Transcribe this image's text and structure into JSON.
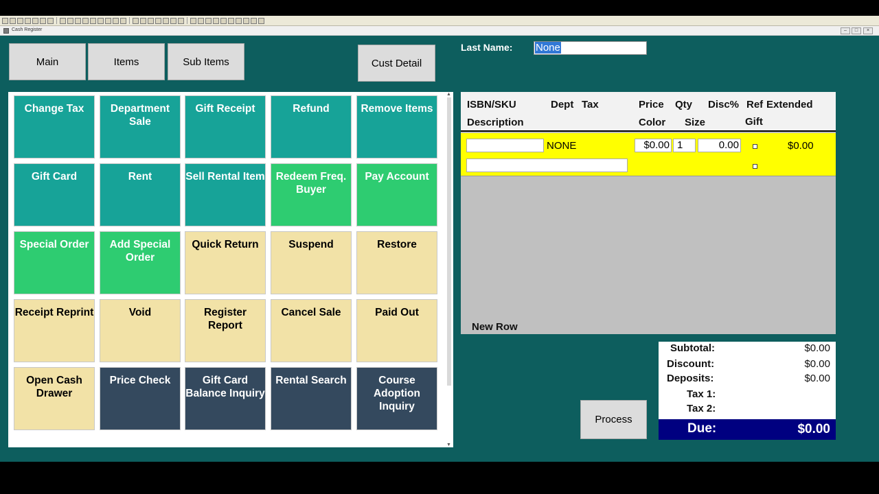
{
  "window": {
    "title": "Cash Register"
  },
  "nav": {
    "main": "Main",
    "items": "Items",
    "sub_items": "Sub Items",
    "cust_detail": "Cust Detail"
  },
  "customer": {
    "last_name_label": "Last Name:",
    "last_name_value": "None"
  },
  "tiles": [
    {
      "label": "Change Tax",
      "color": "#17a398"
    },
    {
      "label": "Department Sale",
      "color": "#17a398"
    },
    {
      "label": "Gift Receipt",
      "color": "#17a398"
    },
    {
      "label": "Refund",
      "color": "#17a398"
    },
    {
      "label": "Remove Items",
      "color": "#17a398"
    },
    {
      "label": "Gift Card",
      "color": "#17a398"
    },
    {
      "label": "Rent",
      "color": "#17a398"
    },
    {
      "label": "Sell Rental Item",
      "color": "#17a398"
    },
    {
      "label": "Redeem Freq. Buyer",
      "color": "#2ecc71"
    },
    {
      "label": "Pay Account",
      "color": "#2ecc71"
    },
    {
      "label": "Special Order",
      "color": "#2ecc71"
    },
    {
      "label": "Add Special Order",
      "color": "#2ecc71"
    },
    {
      "label": "Quick Return",
      "color": "#f2e2a7"
    },
    {
      "label": "Suspend",
      "color": "#f2e2a7"
    },
    {
      "label": "Restore",
      "color": "#f2e2a7"
    },
    {
      "label": "Receipt Reprint",
      "color": "#f2e2a7"
    },
    {
      "label": "Void",
      "color": "#f2e2a7"
    },
    {
      "label": "Register Report",
      "color": "#f2e2a7"
    },
    {
      "label": "Cancel Sale",
      "color": "#f2e2a7"
    },
    {
      "label": "Paid Out",
      "color": "#f2e2a7"
    },
    {
      "label": "Open Cash Drawer",
      "color": "#f2e2a7"
    },
    {
      "label": "Price Check",
      "color": "#34495e"
    },
    {
      "label": "Gift Card Balance Inquiry",
      "color": "#34495e"
    },
    {
      "label": "Rental Search",
      "color": "#34495e"
    },
    {
      "label": "Course Adoption Inquiry",
      "color": "#34495e"
    }
  ],
  "table": {
    "headers": {
      "isbn": "ISBN/SKU",
      "dept": "Dept",
      "tax": "Tax",
      "price": "Price",
      "qty": "Qty",
      "disc": "Disc%",
      "ref": "Ref",
      "extended": "Extended",
      "description": "Description",
      "color": "Color",
      "size": "Size",
      "gift": "Gift"
    },
    "row": {
      "isbn": "",
      "dept": "NONE",
      "price": "$0.00",
      "qty": "1",
      "disc": "0.00",
      "extended": "$0.00",
      "description": ""
    },
    "new_row_label": "New Row"
  },
  "totals": {
    "subtotal_label": "Subtotal:",
    "subtotal": "$0.00",
    "discount_label": "Discount:",
    "discount": "$0.00",
    "deposits_label": "Deposits:",
    "deposits": "$0.00",
    "tax1_label": "Tax 1:",
    "tax1": "",
    "tax2_label": "Tax 2:",
    "tax2": "",
    "due_label": "Due:",
    "due": "$0.00"
  },
  "actions": {
    "process": "Process"
  }
}
